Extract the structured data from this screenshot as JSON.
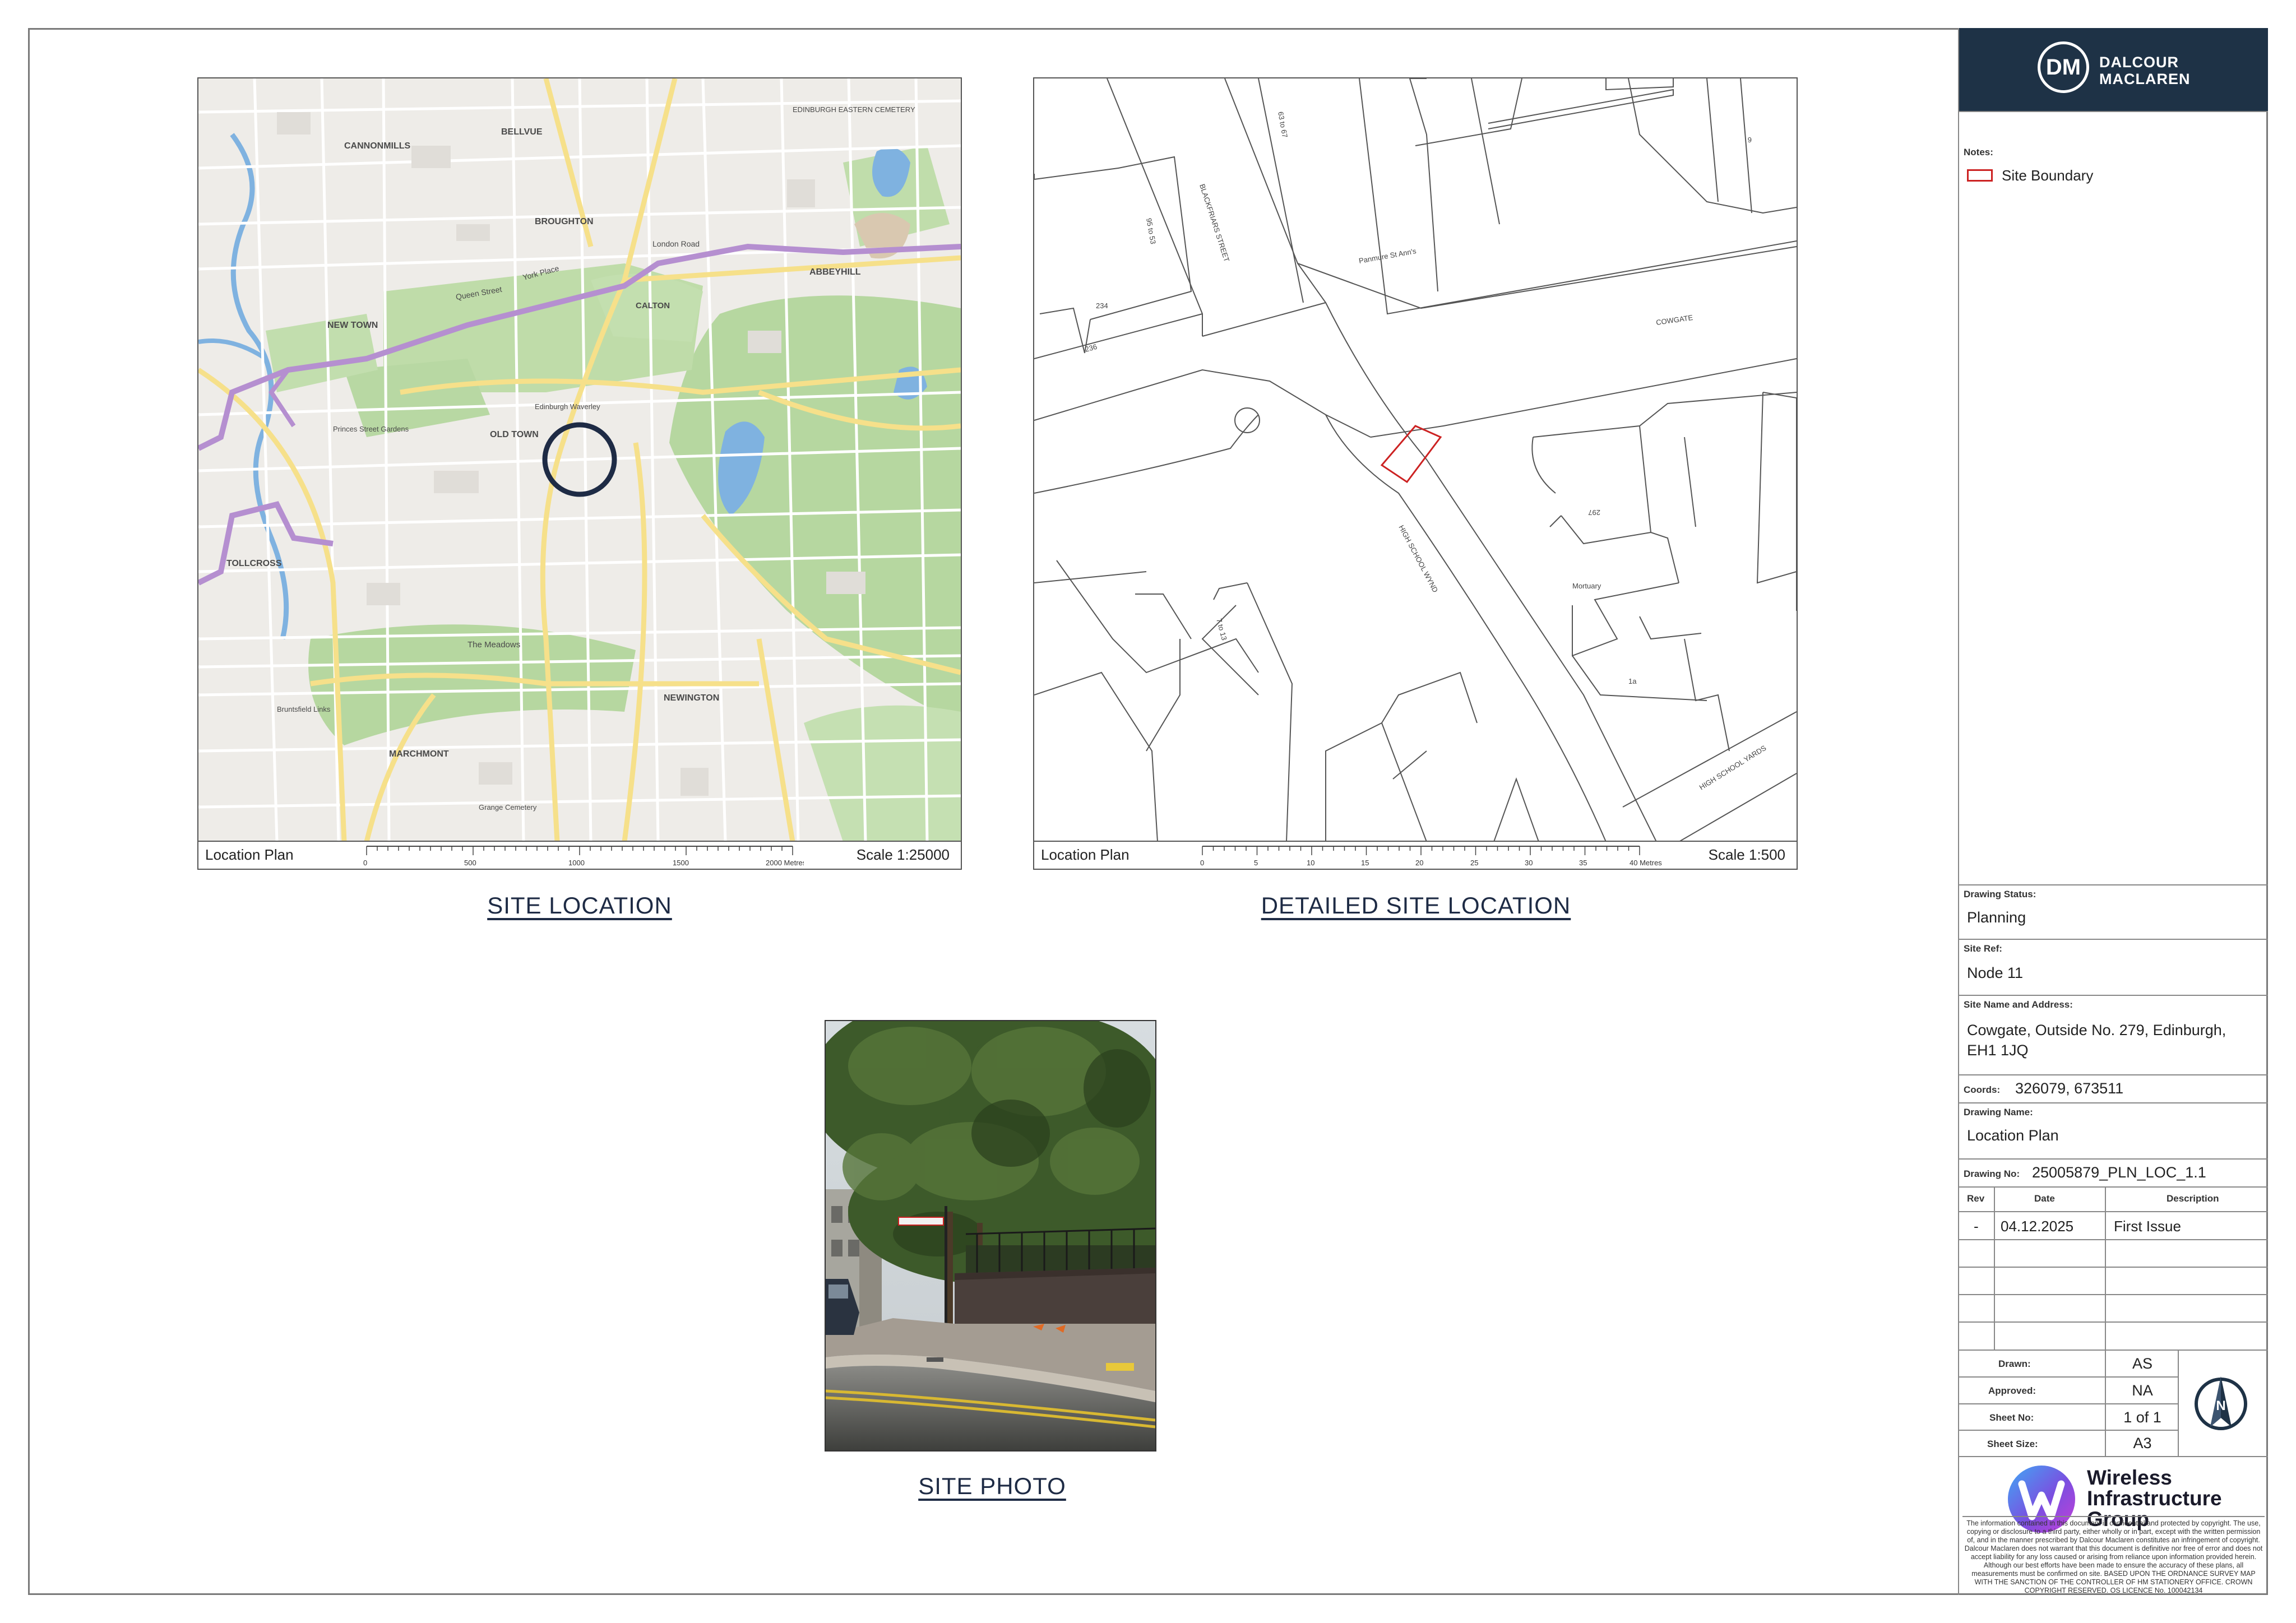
{
  "site_location": {
    "caption": "SITE LOCATION",
    "plan_label": "Location Plan",
    "scale": "Scale 1:25000",
    "scale_ticks": [
      "0",
      "500",
      "1000",
      "1500",
      "2000 Metres"
    ],
    "map_labels": [
      "CANNONMILLS",
      "BELLVUE",
      "BROUGHTON",
      "EDINBURGH EASTERN CEMETERY",
      "NEW TOWN",
      "Queen Street",
      "York Place",
      "London Road",
      "ABBEYHILL",
      "CALTON",
      "OLD TOWN",
      "Princes Street Gardens",
      "Edinburgh Waverley",
      "TOLLCROSS",
      "The Meadows",
      "NEWINGTON",
      "MARCHMONT",
      "Grange Cemetery",
      "Bruntsfield Links"
    ]
  },
  "detailed_location": {
    "caption": "DETAILED SITE LOCATION",
    "plan_label": "Location Plan",
    "scale": "Scale 1:500",
    "scale_ticks": [
      "0",
      "5",
      "10",
      "15",
      "20",
      "25",
      "30",
      "35",
      "40 Metres"
    ],
    "map_labels": [
      "BLACKFRIARS STREET",
      "HIGH SCHOOL WYND",
      "COWGATE",
      "HIGH SCHOOL YARDS",
      "Panmure St Ann's",
      "Mortuary",
      "234",
      "236",
      "63 to 67",
      "95 to 53",
      "7 to 13",
      "1a",
      "297",
      "6"
    ]
  },
  "site_photo": {
    "caption": "SITE PHOTO"
  },
  "title_block": {
    "company_line1": "DALCOUR",
    "company_line2": "MACLAREN",
    "company_initials": "DM",
    "notes_heading": "Notes:",
    "legend_site_boundary": "Site Boundary",
    "drawing_status_heading": "Drawing Status:",
    "drawing_status": "Planning",
    "site_ref_heading": "Site Ref:",
    "site_ref": "Node 11",
    "site_name_heading": "Site Name and Address:",
    "site_name_line1": "Cowgate, Outside No. 279, Edinburgh,",
    "site_name_line2": "EH1 1JQ",
    "coords_heading": "Coords:",
    "coords": "326079, 673511",
    "drawing_name_heading": "Drawing Name:",
    "drawing_name": "Location Plan",
    "drawing_no_heading": "Drawing No:",
    "drawing_no": "25005879_PLN_LOC_1.1",
    "rev_headers": {
      "rev": "Rev",
      "date": "Date",
      "description": "Description"
    },
    "revisions": [
      {
        "rev": "-",
        "date": "04.12.2025",
        "description": "First Issue"
      }
    ],
    "drawn_label": "Drawn:",
    "drawn": "AS",
    "approved_label": "Approved:",
    "approved": "NA",
    "sheet_no_label": "Sheet No:",
    "sheet_no": "1 of 1",
    "sheet_size_label": "Sheet Size:",
    "sheet_size": "A3",
    "north_letter": "N",
    "partner_line1": "Wireless",
    "partner_line2": "Infrastructure",
    "partner_line3": "Group",
    "disclaimer": "The information contained in this document is confidential and protected by copyright. The use, copying or disclosure to a third party, either wholly or in part, except with the written permission of, and in the manner prescribed by Dalcour Maclaren constitutes an infringement of copyright. Dalcour Maclaren does not warrant that this document is definitive nor free of error and does not accept liability for any loss caused or arising from reliance upon information provided herein. Although our best efforts have been made to ensure the accuracy of these plans, all measurements must be confirmed on site. BASED UPON THE ORDNANCE SURVEY MAP WITH THE SANCTION OF THE CONTROLLER OF HM STATIONERY OFFICE. CROWN COPYRIGHT RESERVED. OS LICENCE No. 100042134"
  },
  "colors": {
    "brand_navy": "#1e3246",
    "site_boundary": "#cc2222",
    "caption": "#1e2b45",
    "park_green": "#b6d7a0",
    "water": "#7fb2e0"
  }
}
